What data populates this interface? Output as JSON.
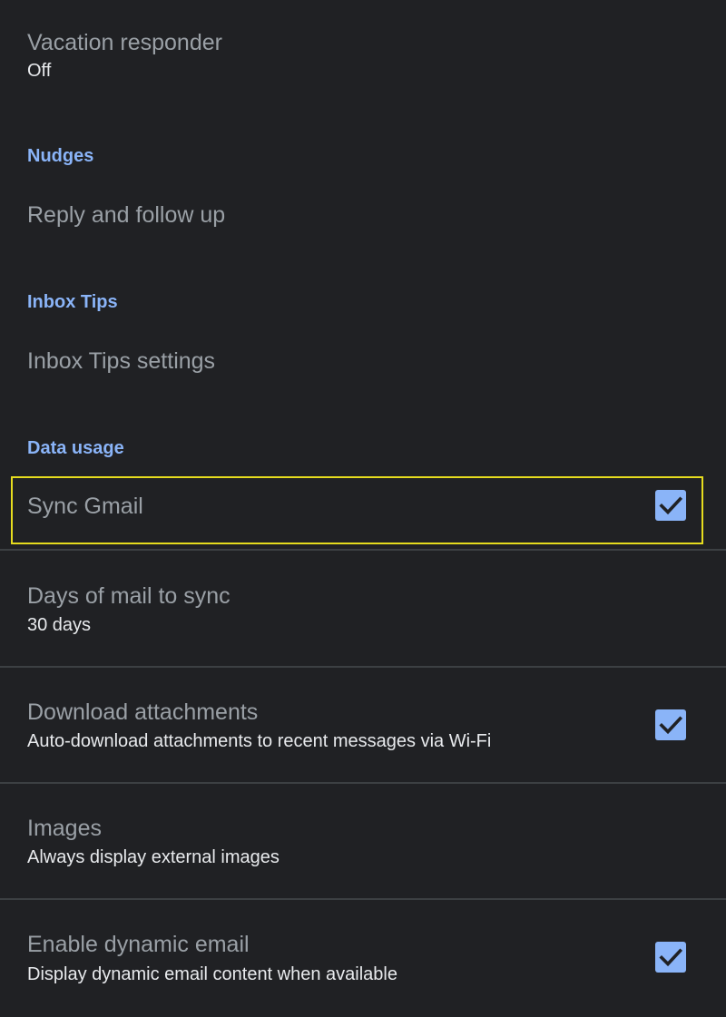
{
  "settings": {
    "vacation_responder": {
      "title": "Vacation responder",
      "value": "Off"
    },
    "nudges": {
      "header": "Nudges",
      "reply_follow_up": "Reply and follow up"
    },
    "inbox_tips": {
      "header": "Inbox Tips",
      "settings_item": "Inbox Tips settings"
    },
    "data_usage": {
      "header": "Data usage",
      "sync_gmail": {
        "title": "Sync Gmail",
        "checked": true
      },
      "days_to_sync": {
        "title": "Days of mail to sync",
        "value": "30 days"
      },
      "download_attachments": {
        "title": "Download attachments",
        "subtitle": "Auto-download attachments to recent messages via Wi-Fi",
        "checked": true
      },
      "images": {
        "title": "Images",
        "subtitle": "Always display external images"
      },
      "dynamic_email": {
        "title": "Enable dynamic email",
        "subtitle": "Display dynamic email content when available",
        "checked": true
      }
    }
  },
  "colors": {
    "background": "#202124",
    "accent": "#8ab4f8",
    "divider": "#3c4043",
    "highlight": "#e6dc1e",
    "check_mark": "#202124"
  },
  "icons": {
    "checkbox": "check-icon"
  }
}
